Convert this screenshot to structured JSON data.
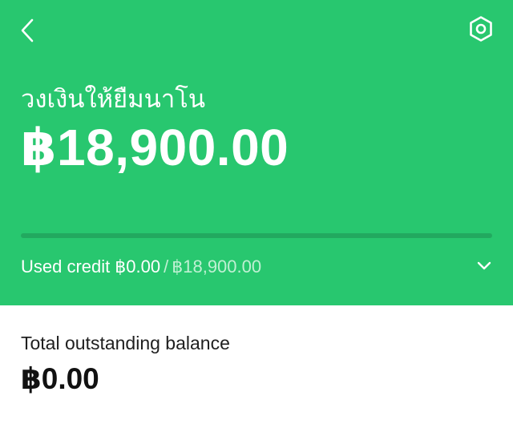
{
  "header": {
    "background_color": "#28c76f",
    "back_icon": "chevron-left-icon",
    "settings_icon": "settings-hex-icon",
    "title": "วงเงินให้ยืมนาโน",
    "credit_limit": "฿18,900.00"
  },
  "usage": {
    "used_label": "Used credit",
    "used_amount": "฿0.00",
    "separator": "/",
    "limit_amount": "฿18,900.00",
    "used_fraction": 0,
    "expand_icon": "chevron-down-icon"
  },
  "balance": {
    "label": "Total outstanding balance",
    "amount": "฿0.00"
  }
}
